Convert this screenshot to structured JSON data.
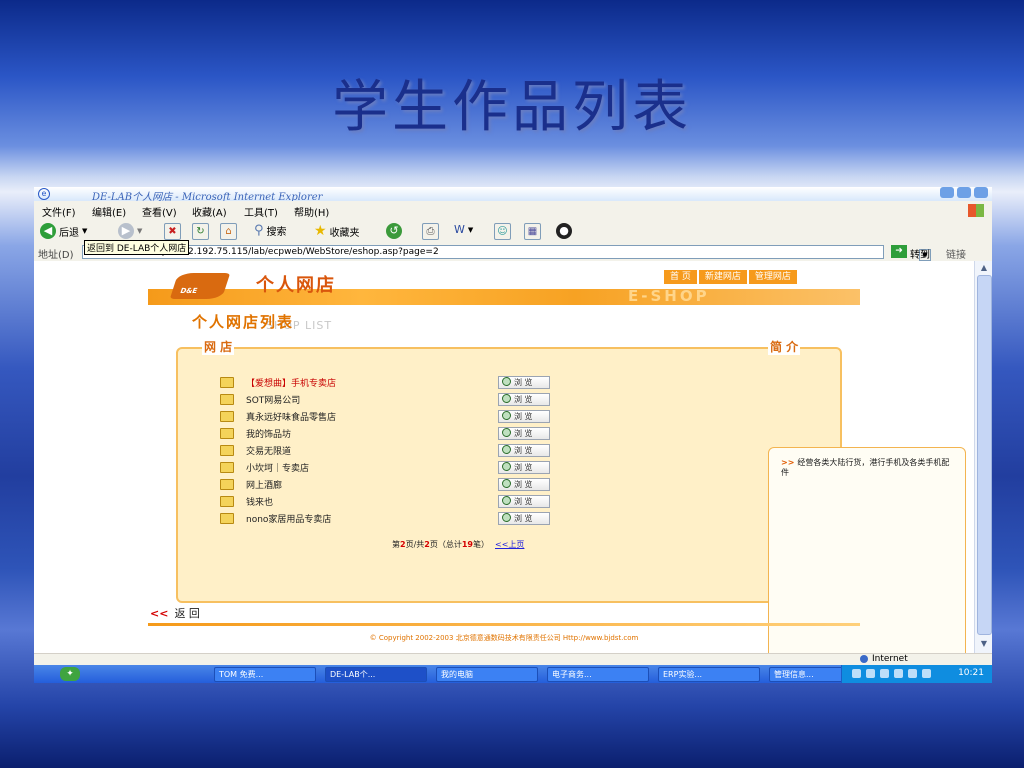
{
  "slide": {
    "title": "学生作品列表"
  },
  "window": {
    "title": "DE-LAB个人网店 - Microsoft Internet Explorer",
    "menu": [
      "文件(F)",
      "编辑(E)",
      "查看(V)",
      "收藏(A)",
      "工具(T)",
      "帮助(H)"
    ],
    "toolbar": {
      "back": "后退",
      "search": "搜索",
      "favorites": "收藏夹"
    },
    "tooltip": "返回到 DE-LAB个人网店",
    "address": {
      "label": "地址(D)",
      "url": "http://202.192.75.115/lab/ecpweb/WebStore/eshop.asp?page=2",
      "go": "转到",
      "links": "链接"
    }
  },
  "page": {
    "brand": "个人网店",
    "logo_text": "D&E",
    "banner_eshop": "E-SHOP",
    "nav": [
      "首 页",
      "新建网店",
      "管理网店"
    ],
    "list_title": "个人网店列表",
    "list_subtitle": "SHOP LIST",
    "shops_label": "网 店",
    "intro_label": "简 介",
    "intro_arrow": ">>",
    "intro_text": "经营各类大陆行货，港行手机及各类手机配件",
    "browse_label": "浏 览",
    "shops": [
      "【爱想曲】手机专卖店",
      "SOT网易公司",
      "真永远好味食品零售店",
      "我的饰品坊",
      "交易无限道",
      "小坎坷｜专卖店",
      "网上酒廊",
      "钱来也",
      "nono家居用品专卖店"
    ],
    "pager": {
      "prefix": "第",
      "page": "2",
      "mid": "页/共",
      "total_pages": "2",
      "mid2": "页（总计",
      "total": "19",
      "suffix": "笔）",
      "prev": "<<上页"
    },
    "back_chev": "<<",
    "back_label": "返 回",
    "footer": "© Copyright 2002-2003 北京德意通数码技术有限责任公司 Http://www.bjdst.com"
  },
  "status": {
    "zone": "Internet"
  },
  "taskbar": {
    "tasks": [
      "TOM 免费...",
      "DE-LAB个...",
      "我的电脑",
      "电子商务...",
      "ERP实验...",
      "管理信息..."
    ],
    "time": "10:21"
  }
}
